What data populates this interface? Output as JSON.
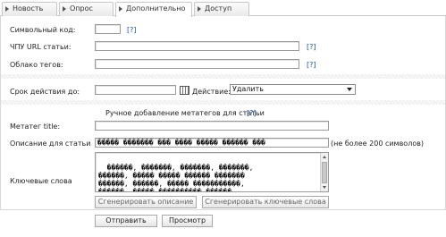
{
  "tabs": [
    {
      "label": "Новость"
    },
    {
      "label": "Опрос"
    },
    {
      "label": "Дополнительно"
    },
    {
      "label": "Доступ"
    }
  ],
  "form": {
    "symbol_code_label": "Символьный код:",
    "symbol_code_value": "",
    "help_mark": "[?]",
    "url_label": "ЧПУ URL статьи:",
    "url_value": "",
    "tags_label": "Облако тегов:",
    "tags_value": "",
    "expiry_label": "Срок действия до:",
    "expiry_value": "",
    "action_label": "Действие:",
    "action_selected": "Удалить",
    "meta_section_title": "Ручное добавление метатегов для статьи",
    "metatitle_label": "Метатег title:",
    "metatitle_value": "",
    "description_label": "Описание для статьи",
    "description_value": "����� ������� ��� ���� ����� ������ ���",
    "description_limit": "(не более 200 символов)",
    "keywords_label": "Ключевые слова",
    "keywords_value": "������, �������, �������, �������,\n������, ����� ����� ������ �������\n������, ������, ����� �����������,\n������, ����� ���������� ������,\n�������. �����. ������. ������.",
    "generate_description_button": "Сгенерировать описание",
    "generate_keywords_button": "Сгенерировать ключевые слова"
  },
  "footer": {
    "submit_button": "Отправить",
    "preview_button": "Просмотр"
  },
  "colors": {
    "help_link": "#1a52a6",
    "border": "#9a9a9a"
  }
}
